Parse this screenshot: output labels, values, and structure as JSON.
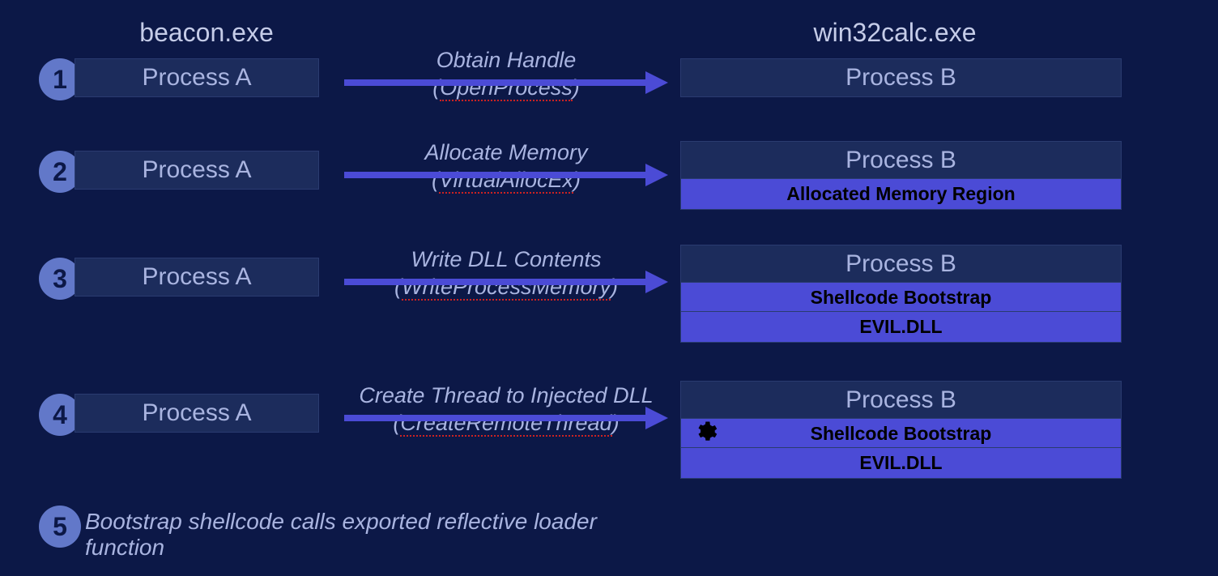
{
  "headers": {
    "left": "beacon.exe",
    "right": "win32calc.exe"
  },
  "procA": "Process A",
  "procB": "Process B",
  "steps": {
    "s1": {
      "num": "1",
      "label_top": "Obtain Handle",
      "api": "OpenProcess"
    },
    "s2": {
      "num": "2",
      "label_top": "Allocate Memory",
      "api": "VirtualAllocEx",
      "mem1": "Allocated Memory Region"
    },
    "s3": {
      "num": "3",
      "label_top": "Write DLL Contents",
      "api": "WriteProcessMemory",
      "mem1": "Shellcode Bootstrap",
      "mem2": "EVIL.DLL"
    },
    "s4": {
      "num": "4",
      "label_top": "Create Thread to Injected DLL",
      "api": "CreateRemoteThread",
      "mem1": "Shellcode Bootstrap",
      "mem2": "EVIL.DLL"
    },
    "s5": {
      "num": "5",
      "text": "Bootstrap shellcode calls exported reflective loader function"
    }
  },
  "paren_open": "(",
  "paren_close": ")"
}
